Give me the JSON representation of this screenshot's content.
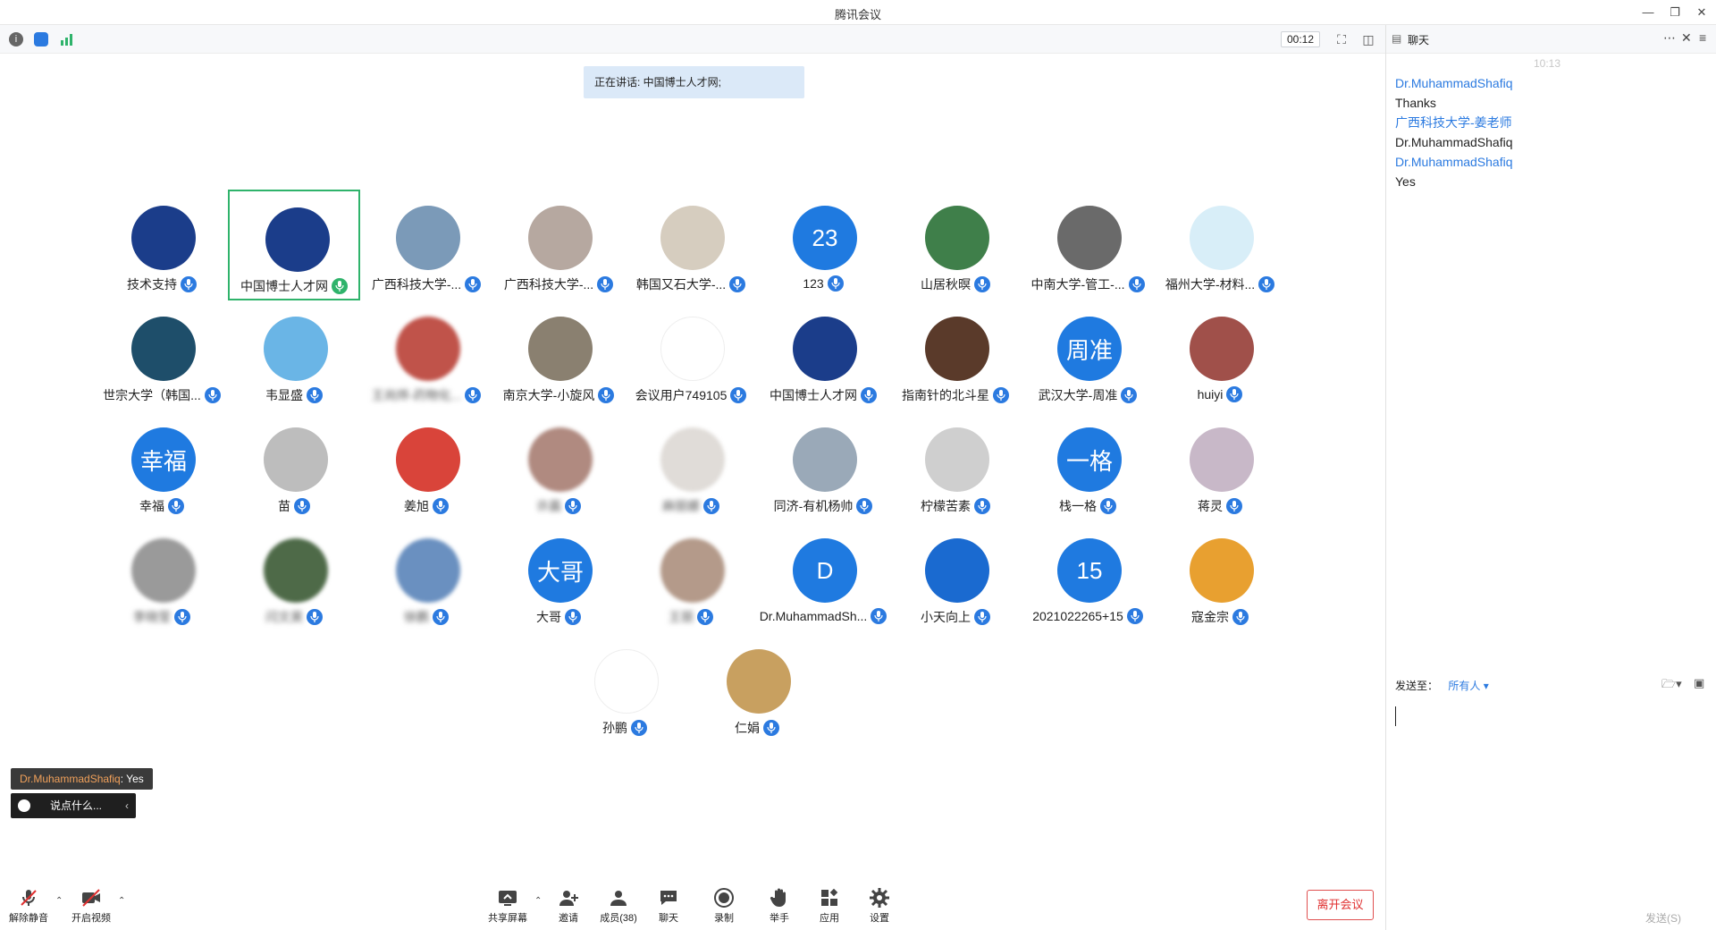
{
  "window": {
    "title": "腾讯会议"
  },
  "infobar": {
    "timer": "00:12"
  },
  "speaking": {
    "text": "正在讲话: 中国博士人才网;"
  },
  "participants": [
    {
      "name": "技术支持",
      "avatar_text": "",
      "avatar_color": "#1b3d8a",
      "blurred": false,
      "selected": false
    },
    {
      "name": "中国博士人才网",
      "avatar_text": "",
      "avatar_color": "#1b3d8a",
      "blurred": false,
      "selected": true
    },
    {
      "name": "广西科技大学-...",
      "avatar_text": "",
      "avatar_color": "#7b9ab8",
      "blurred": false,
      "selected": false
    },
    {
      "name": "广西科技大学-...",
      "avatar_text": "",
      "avatar_color": "#b6a8a0",
      "blurred": false,
      "selected": false
    },
    {
      "name": "韩国又石大学-...",
      "avatar_text": "",
      "avatar_color": "#d6cdbf",
      "blurred": false,
      "selected": false
    },
    {
      "name": "123",
      "avatar_text": "23",
      "avatar_color": "#1f7ae0",
      "blurred": false,
      "selected": false
    },
    {
      "name": "山居秋暝",
      "avatar_text": "",
      "avatar_color": "#3f7f4a",
      "blurred": false,
      "selected": false
    },
    {
      "name": "中南大学-管工-...",
      "avatar_text": "",
      "avatar_color": "#6a6a6a",
      "blurred": false,
      "selected": false
    },
    {
      "name": "福州大学-材料...",
      "avatar_text": "",
      "avatar_color": "#d8eef8",
      "blurred": false,
      "selected": false
    },
    {
      "name": "世宗大学（韩国...",
      "avatar_text": "",
      "avatar_color": "#1e4e6a",
      "blurred": false,
      "selected": false
    },
    {
      "name": "韦显盛",
      "avatar_text": "",
      "avatar_color": "#6ab5e6",
      "blurred": false,
      "selected": false
    },
    {
      "name": "王尚烨-药物化...",
      "avatar_text": "",
      "avatar_color": "#c0534a",
      "blurred": true,
      "selected": false
    },
    {
      "name": "南京大学-小旋风",
      "avatar_text": "",
      "avatar_color": "#8a8070",
      "blurred": false,
      "selected": false
    },
    {
      "name": "会议用户749105",
      "avatar_text": "",
      "avatar_color": "#ffffff",
      "blurred": false,
      "selected": false
    },
    {
      "name": "中国博士人才网",
      "avatar_text": "",
      "avatar_color": "#1b3d8a",
      "blurred": false,
      "selected": false
    },
    {
      "name": "指南针的北斗星",
      "avatar_text": "",
      "avatar_color": "#5a3a2a",
      "blurred": false,
      "selected": false
    },
    {
      "name": "武汉大学-周准",
      "avatar_text": "周准",
      "avatar_color": "#1f7ae0",
      "blurred": false,
      "selected": false
    },
    {
      "name": "huiyi",
      "avatar_text": "",
      "avatar_color": "#a0504a",
      "blurred": false,
      "selected": false
    },
    {
      "name": "幸福",
      "avatar_text": "幸福",
      "avatar_color": "#1f7ae0",
      "blurred": false,
      "selected": false
    },
    {
      "name": "苗",
      "avatar_text": "",
      "avatar_color": "#bdbdbd",
      "blurred": false,
      "selected": false
    },
    {
      "name": "姜旭",
      "avatar_text": "",
      "avatar_color": "#d9443a",
      "blurred": false,
      "selected": false
    },
    {
      "name": "许晨",
      "avatar_text": "",
      "avatar_color": "#b08a80",
      "blurred": true,
      "selected": false
    },
    {
      "name": "麻丽娜",
      "avatar_text": "",
      "avatar_color": "#e0dcd8",
      "blurred": true,
      "selected": false
    },
    {
      "name": "同济-有机杨帅",
      "avatar_text": "",
      "avatar_color": "#9aa9b8",
      "blurred": false,
      "selected": false
    },
    {
      "name": "柠檬苦素",
      "avatar_text": "",
      "avatar_color": "#cfcfcf",
      "blurred": false,
      "selected": false
    },
    {
      "name": "栈一格",
      "avatar_text": "一格",
      "avatar_color": "#1f7ae0",
      "blurred": false,
      "selected": false
    },
    {
      "name": "蒋灵",
      "avatar_text": "",
      "avatar_color": "#c8b8c8",
      "blurred": false,
      "selected": false
    },
    {
      "name": "李晓莹",
      "avatar_text": "",
      "avatar_color": "#9a9a9a",
      "blurred": true,
      "selected": false
    },
    {
      "name": "闫文昊",
      "avatar_text": "",
      "avatar_color": "#4e6a48",
      "blurred": true,
      "selected": false
    },
    {
      "name": "徐鹏",
      "avatar_text": "",
      "avatar_color": "#6a90c0",
      "blurred": true,
      "selected": false
    },
    {
      "name": "大哥",
      "avatar_text": "大哥",
      "avatar_color": "#1f7ae0",
      "blurred": false,
      "selected": false
    },
    {
      "name": "王丽",
      "avatar_text": "",
      "avatar_color": "#b49a8a",
      "blurred": true,
      "selected": false
    },
    {
      "name": "Dr.MuhammadSh...",
      "avatar_text": "D",
      "avatar_color": "#1f7ae0",
      "blurred": false,
      "selected": false
    },
    {
      "name": "小天向上",
      "avatar_text": "",
      "avatar_color": "#1a6ad0",
      "blurred": false,
      "selected": false
    },
    {
      "name": "2021022265+15",
      "avatar_text": "15",
      "avatar_color": "#1f7ae0",
      "blurred": false,
      "selected": false
    },
    {
      "name": "寇金宗",
      "avatar_text": "",
      "avatar_color": "#e8a030",
      "blurred": false,
      "selected": false
    },
    {
      "name": "孙鹏",
      "avatar_text": "",
      "avatar_color": "#ffffff",
      "blurred": false,
      "selected": false
    },
    {
      "name": "仁娟",
      "avatar_text": "",
      "avatar_color": "#c8a060",
      "blurred": false,
      "selected": false
    }
  ],
  "chat_preview": {
    "sender": "Dr.MuhammadShafiq",
    "message": "Yes"
  },
  "say_box": {
    "placeholder": "说点什么..."
  },
  "toolbar": {
    "unmute": "解除静音",
    "video": "开启视频",
    "share": "共享屏幕",
    "invite": "邀请",
    "members": "成员(38)",
    "chat": "聊天",
    "record": "录制",
    "raise_hand": "举手",
    "apps": "应用",
    "settings": "设置",
    "leave": "离开会议"
  },
  "chat_panel": {
    "title": "聊天",
    "time": "10:13",
    "messages": [
      {
        "kind": "sender",
        "text": "Dr.MuhammadShafiq"
      },
      {
        "kind": "msg",
        "text": "Thanks"
      },
      {
        "kind": "sender",
        "text": "广西科技大学-姜老师"
      },
      {
        "kind": "msg",
        "text": "Dr.MuhammadShafiq"
      },
      {
        "kind": "sender",
        "text": "Dr.MuhammadShafiq"
      },
      {
        "kind": "msg",
        "text": "Yes"
      }
    ],
    "send_to_label": "发送至：",
    "send_to_target": "所有人",
    "send_button": "发送(S)"
  }
}
